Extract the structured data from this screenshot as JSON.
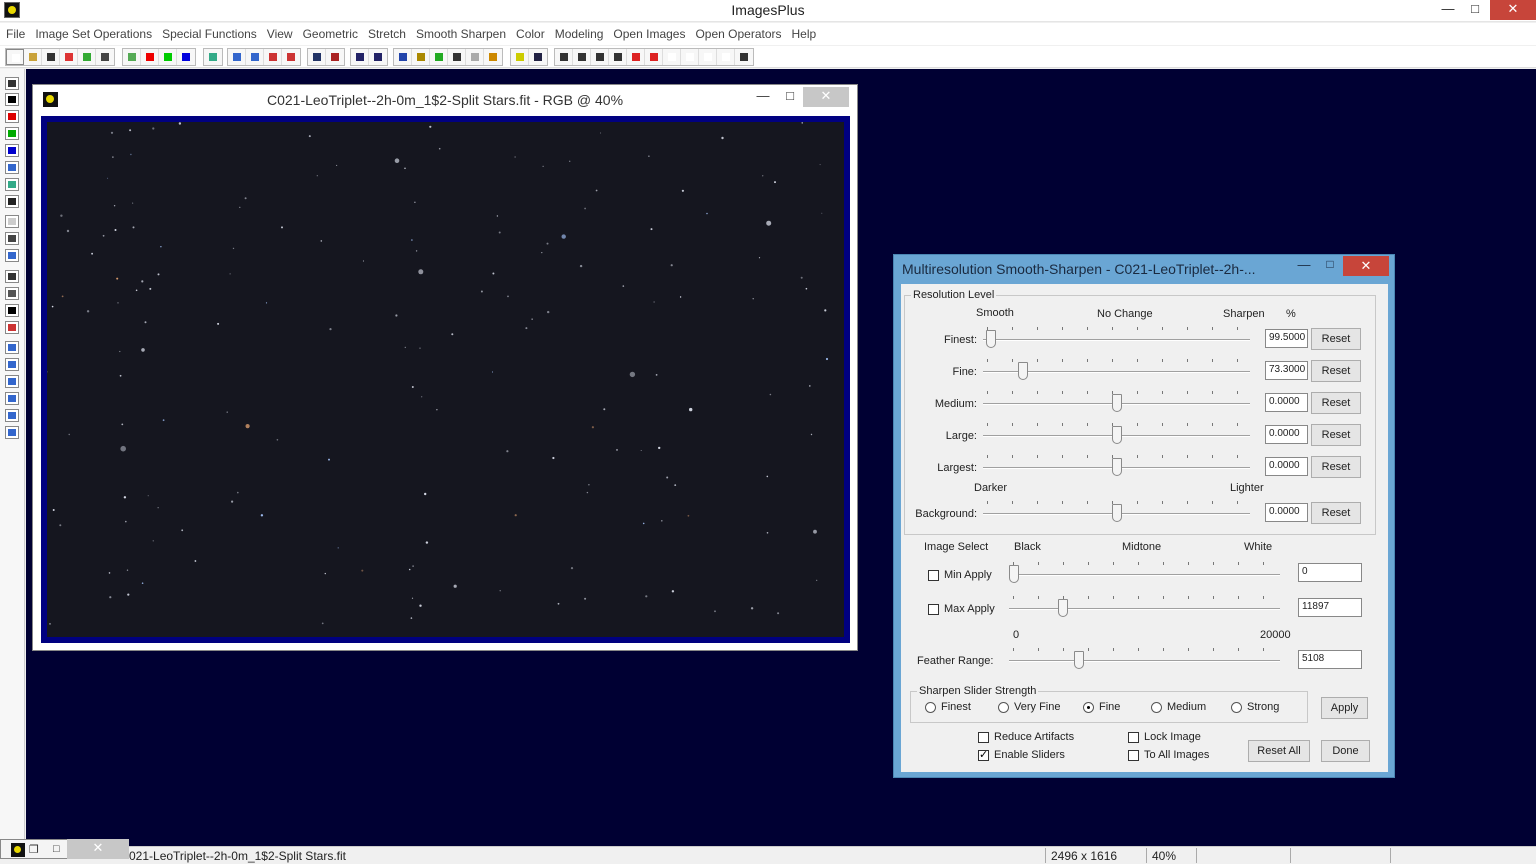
{
  "app": {
    "title": "ImagesPlus"
  },
  "menu": [
    "File",
    "Image Set Operations",
    "Special Functions",
    "View",
    "Geometric",
    "Stretch",
    "Smooth Sharpen",
    "Color",
    "Modeling",
    "Open Images",
    "Open Operators",
    "Help"
  ],
  "image_window": {
    "title": "C021-LeoTriplet--2h-0m_1$2-Split Stars.fit - RGB @ 40%"
  },
  "dialog": {
    "title": "Multiresolution Smooth-Sharpen - C021-LeoTriplet--2h-...",
    "resolution_group": "Resolution Level",
    "hdr_smooth": "Smooth",
    "hdr_nochange": "No Change",
    "hdr_sharpen": "Sharpen",
    "hdr_percent": "%",
    "hdr_darker": "Darker",
    "hdr_lighter": "Lighter",
    "reset_label": "Reset",
    "levels": [
      {
        "label": "Finest:",
        "value": "99.5000",
        "pos": 0.03
      },
      {
        "label": "Fine:",
        "value": "73.3000",
        "pos": 0.15
      },
      {
        "label": "Medium:",
        "value": "0.0000",
        "pos": 0.5
      },
      {
        "label": "Large:",
        "value": "0.0000",
        "pos": 0.5
      },
      {
        "label": "Largest:",
        "value": "0.0000",
        "pos": 0.5
      },
      {
        "label": "Background:",
        "value": "0.0000",
        "pos": 0.5
      }
    ],
    "image_select": "Image Select",
    "hdr_black": "Black",
    "hdr_midtone": "Midtone",
    "hdr_white": "White",
    "min_apply": {
      "label": "Min Apply",
      "value": "0",
      "checked": false,
      "pos": 0.02
    },
    "max_apply": {
      "label": "Max Apply",
      "value": "11897",
      "checked": false,
      "pos": 0.2
    },
    "range_min": "0",
    "range_max": "20000",
    "feather": {
      "label": "Feather Range:",
      "value": "5108",
      "pos": 0.26
    },
    "strength_group": "Sharpen Slider Strength",
    "strength_options": [
      {
        "label": "Finest",
        "selected": false
      },
      {
        "label": "Very Fine",
        "selected": false
      },
      {
        "label": "Fine",
        "selected": true
      },
      {
        "label": "Medium",
        "selected": false
      },
      {
        "label": "Strong",
        "selected": false
      }
    ],
    "apply_label": "Apply",
    "reduce_artifacts": {
      "label": "Reduce Artifacts",
      "checked": false
    },
    "enable_sliders": {
      "label": "Enable Sliders",
      "checked": true
    },
    "lock_image": {
      "label": "Lock Image",
      "checked": false
    },
    "to_all_images": {
      "label": "To All Images",
      "checked": false
    },
    "reset_all_label": "Reset All",
    "done_label": "Done"
  },
  "statusbar": {
    "filename": "021-LeoTriplet--2h-0m_1$2-Split Stars.fit",
    "dimensions": "2496 x 1616",
    "zoom": "40%"
  },
  "colors": {
    "workspace": "#000033",
    "image_border": "#000080",
    "dialog_frame": "#6aa6d4",
    "close_red": "#c7453a"
  }
}
